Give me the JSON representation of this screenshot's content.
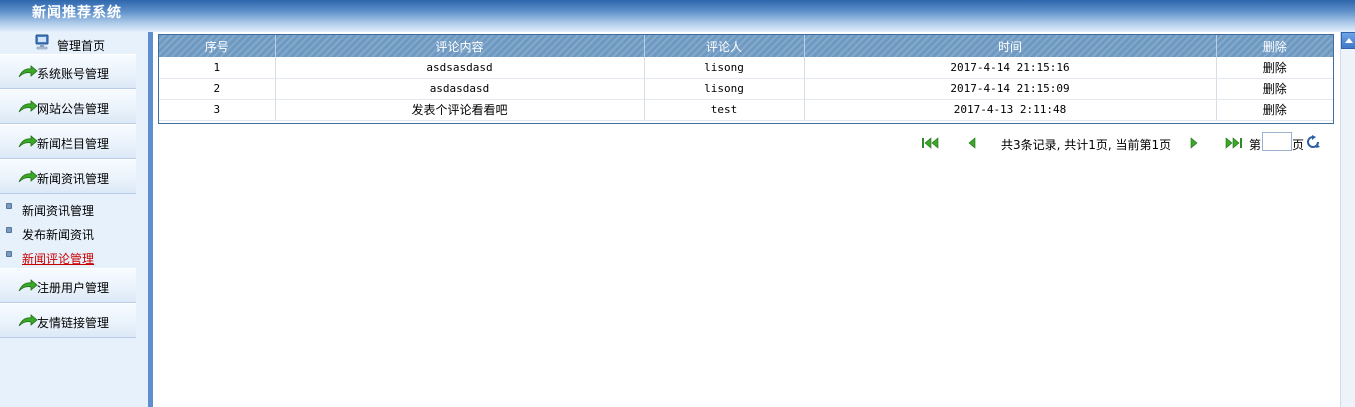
{
  "app": {
    "title": "新闻推荐系统"
  },
  "sidebar": {
    "home_label": "管理首页",
    "menus": [
      {
        "label": "系统账号管理"
      },
      {
        "label": "网站公告管理"
      },
      {
        "label": "新闻栏目管理"
      },
      {
        "label": "新闻资讯管理"
      }
    ],
    "subitems": [
      {
        "label": "新闻资讯管理",
        "active": false
      },
      {
        "label": "发布新闻资讯",
        "active": false
      },
      {
        "label": "新闻评论管理",
        "active": true
      }
    ],
    "menus_after": [
      {
        "label": "注册用户管理"
      },
      {
        "label": "友情链接管理"
      }
    ]
  },
  "table": {
    "headers": [
      "序号",
      "评论内容",
      "评论人",
      "时间",
      "删除"
    ],
    "rows": [
      {
        "index": "1",
        "content": "asdsasdasd",
        "author": "lisong",
        "time": "2017-4-14 21:15:16",
        "action": "删除"
      },
      {
        "index": "2",
        "content": "asdasdasd",
        "author": "lisong",
        "time": "2017-4-14 21:15:09",
        "action": "删除"
      },
      {
        "index": "3",
        "content": "发表个评论看看吧",
        "author": "test",
        "time": "2017-4-13 2:11:48",
        "action": "删除"
      }
    ]
  },
  "pager": {
    "info": "共3条记录, 共计1页, 当前第1页",
    "goto_prefix": "第",
    "goto_suffix": "页",
    "goto_value": ""
  },
  "colors": {
    "header_top": "#2e66ad",
    "table_header": "#6f99c0",
    "active_sub": "#cc0000",
    "divider": "#5d8fd0"
  }
}
